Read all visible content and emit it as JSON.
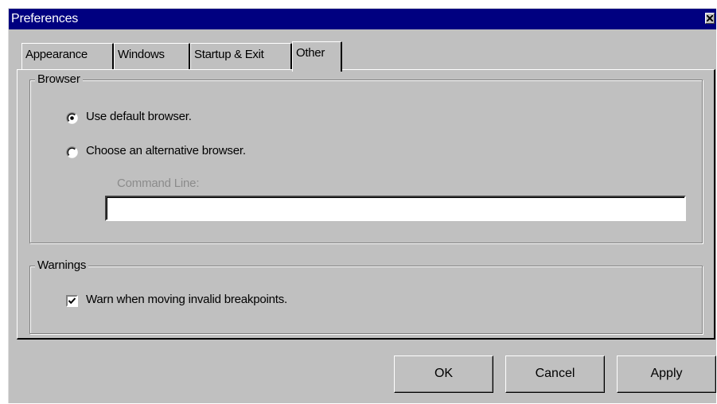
{
  "window": {
    "title": "Preferences"
  },
  "tabs": [
    {
      "label": "Appearance",
      "active": false
    },
    {
      "label": "Windows",
      "active": false
    },
    {
      "label": "Startup & Exit",
      "active": false
    },
    {
      "label": "Other",
      "active": true
    }
  ],
  "browser_group": {
    "label": "Browser",
    "options": [
      {
        "label": "Use default browser.",
        "selected": true
      },
      {
        "label": "Choose an alternative browser.",
        "selected": false
      }
    ],
    "command_line": {
      "label": "Command Line:",
      "value": ""
    }
  },
  "warnings_group": {
    "label": "Warnings",
    "checkbox": {
      "label": "Warn when moving invalid breakpoints.",
      "checked": true
    }
  },
  "buttons": {
    "ok": "OK",
    "cancel": "Cancel",
    "apply": "Apply"
  },
  "colors": {
    "titlebar": "#000080",
    "face": "#c0c0c0",
    "disabled_text": "#8b8b8b"
  }
}
